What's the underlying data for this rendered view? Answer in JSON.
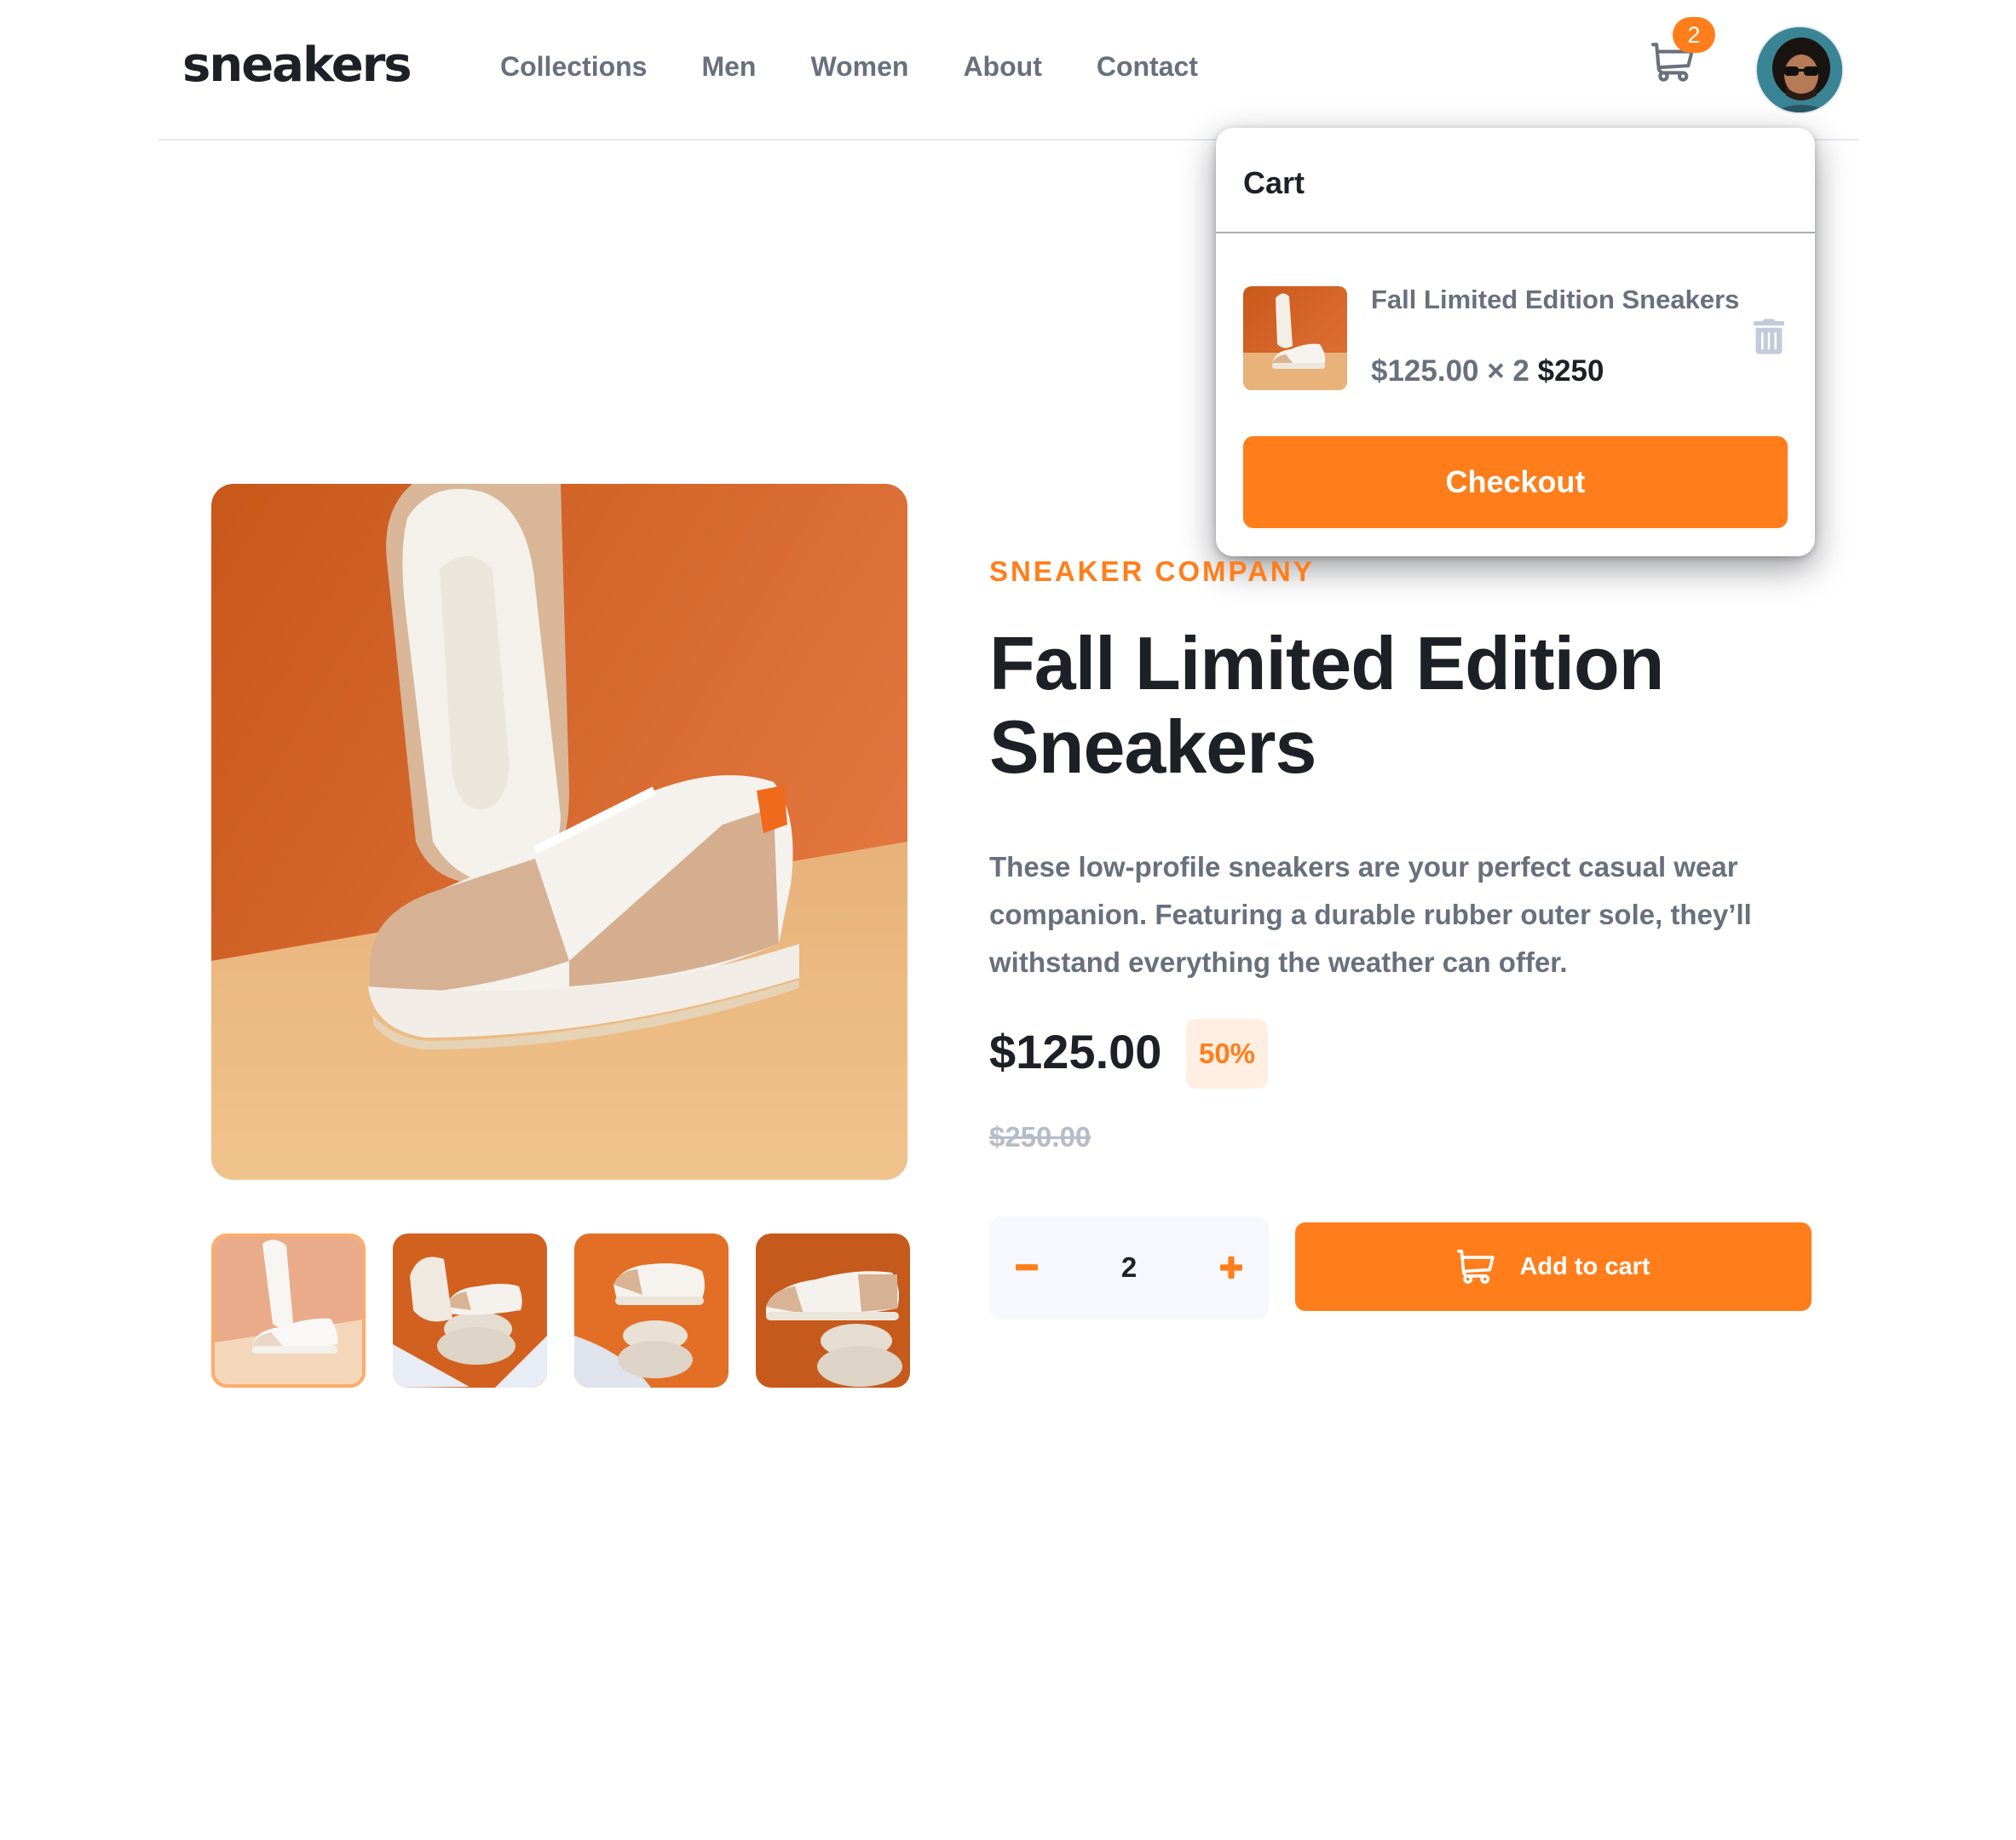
{
  "header": {
    "logo": "sneakers",
    "nav": [
      {
        "label": "Collections"
      },
      {
        "label": "Men"
      },
      {
        "label": "Women"
      },
      {
        "label": "About"
      },
      {
        "label": "Contact"
      }
    ],
    "cart_count": "2"
  },
  "cart": {
    "title": "Cart",
    "item": {
      "name": "Fall Limited Edition Sneakers",
      "unit_price": "$125.00 × 2",
      "total": "$250"
    },
    "checkout_label": "Checkout"
  },
  "product": {
    "company": "SNEAKER COMPANY",
    "title": "Fall Limited Edition Sneakers",
    "description": "These low-profile sneakers are your perfect casual wear companion. Featuring a durable rubber outer sole, they’ll withstand everything the weather can offer.",
    "price": "$125.00",
    "discount": "50%",
    "old_price": "$250.00",
    "quantity": "2",
    "add_to_cart_label": "Add to cart"
  },
  "gallery": {
    "thumbnails": 4,
    "active_thumbnail": 1
  },
  "colors": {
    "accent": "#ff7e1b",
    "accent_pale": "#ffeee2",
    "text_dark": "#1d2026",
    "text_gray": "#69707d",
    "text_light": "#b6bcc8"
  },
  "icons": [
    "cart-icon",
    "avatar",
    "trash-icon",
    "minus-icon",
    "plus-icon"
  ]
}
